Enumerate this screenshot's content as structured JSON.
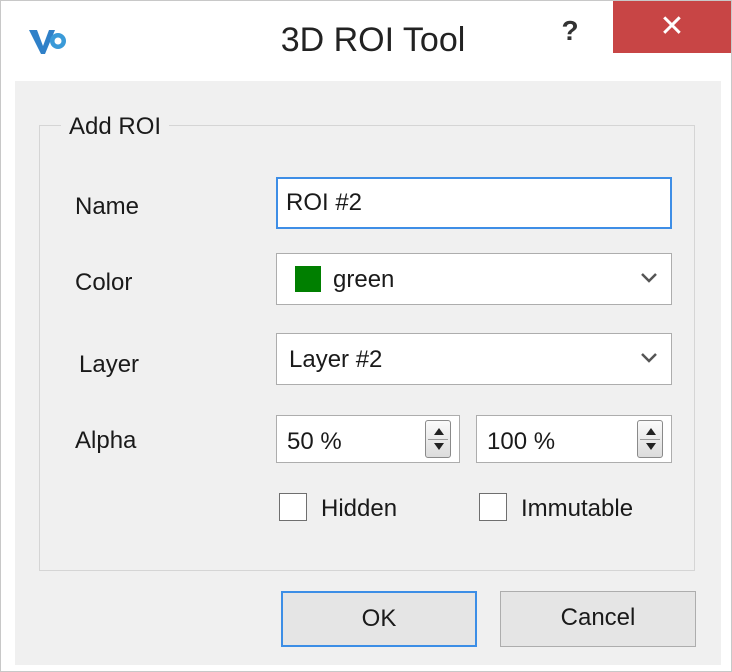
{
  "window": {
    "title": "3D ROI Tool",
    "help_label": "?",
    "close_label": "✕"
  },
  "group": {
    "title": "Add ROI"
  },
  "fields": {
    "name_label": "Name",
    "name_value": "ROI #2",
    "color_label": "Color",
    "color_value": "green",
    "color_swatch": "#007f00",
    "layer_label": "Layer",
    "layer_value": "Layer #2",
    "alpha_label": "Alpha",
    "alpha_min": "50 %",
    "alpha_max": "100 %"
  },
  "checkboxes": {
    "hidden_label": "Hidden",
    "immutable_label": "Immutable"
  },
  "buttons": {
    "ok_label": "OK",
    "cancel_label": "Cancel"
  },
  "icons": {
    "app": "app-logo-icon",
    "dropdown": "chevron-down-icon",
    "spin": "spin-arrows-icon"
  },
  "colors": {
    "accent": "#3e8ee6",
    "close": "#c84545"
  }
}
